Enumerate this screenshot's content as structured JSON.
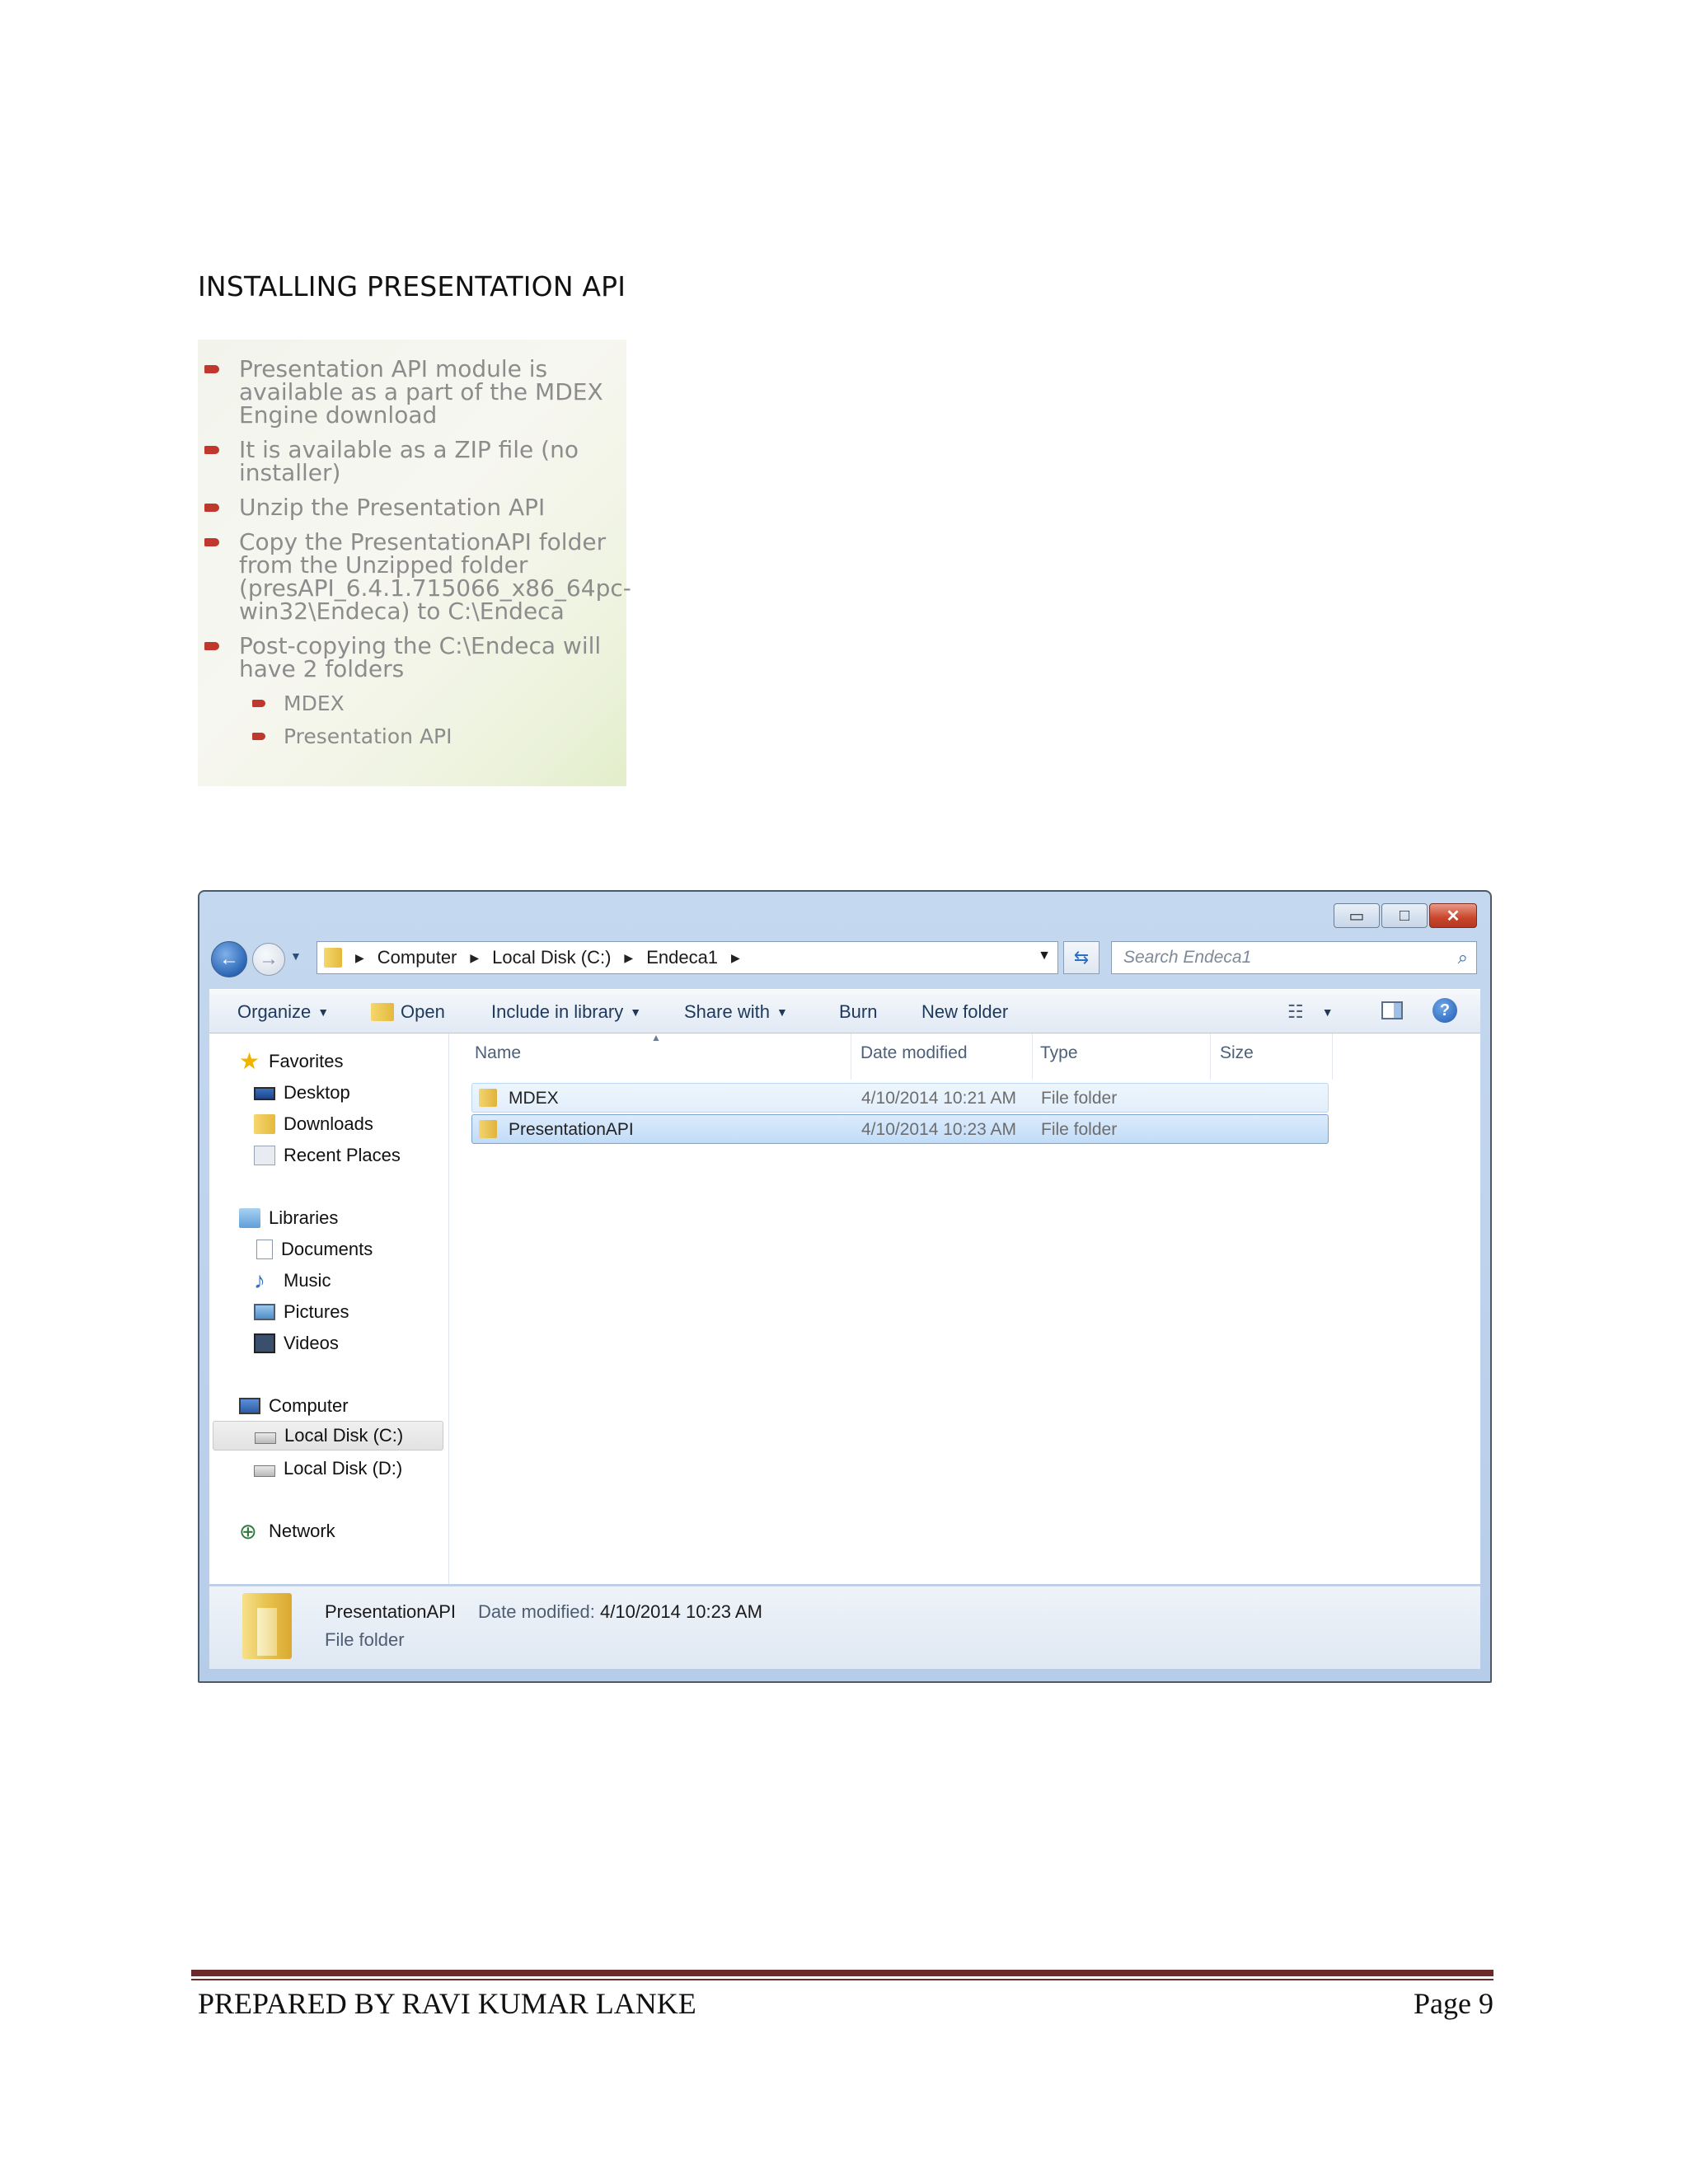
{
  "document": {
    "section_title": "INSTALLING PRESENTATION API",
    "slide_bullets": [
      "Presentation API module is available as a part of the MDEX Engine download",
      "It is available as a ZIP file (no installer)",
      "Unzip the Presentation API",
      "Copy the PresentationAPI folder from the Unzipped folder (presAPI_6.4.1.715066_x86_64pc-win32\\Endeca) to C:\\Endeca",
      "Post-copying the C:\\Endeca will have 2 folders"
    ],
    "slide_subbullets": [
      "MDEX",
      "Presentation API"
    ],
    "footer_left": "PREPARED BY RAVI KUMAR LANKE",
    "footer_right": "Page 9"
  },
  "explorer": {
    "breadcrumb": [
      "Computer",
      "Local Disk (C:)",
      "Endeca1"
    ],
    "search_placeholder": "Search Endeca1",
    "toolbar": {
      "organize": "Organize",
      "open": "Open",
      "include_in_library": "Include in library",
      "share_with": "Share with",
      "burn": "Burn",
      "new_folder": "New folder"
    },
    "nav": {
      "favorites": "Favorites",
      "desktop": "Desktop",
      "downloads": "Downloads",
      "recent_places": "Recent Places",
      "libraries": "Libraries",
      "documents": "Documents",
      "music": "Music",
      "pictures": "Pictures",
      "videos": "Videos",
      "computer": "Computer",
      "local_disk_c": "Local Disk (C:)",
      "local_disk_d": "Local Disk (D:)",
      "network": "Network"
    },
    "columns": {
      "name": "Name",
      "date_modified": "Date modified",
      "type": "Type",
      "size": "Size"
    },
    "rows": [
      {
        "name": "MDEX",
        "date": "4/10/2014 10:21 AM",
        "type": "File folder"
      },
      {
        "name": "PresentationAPI",
        "date": "4/10/2014 10:23 AM",
        "type": "File folder"
      }
    ],
    "details": {
      "name": "PresentationAPI",
      "date_label": "Date modified:",
      "date_value": "4/10/2014 10:23 AM",
      "type": "File folder"
    },
    "icons": {
      "back": "back-arrow-icon",
      "forward": "forward-arrow-icon",
      "refresh": "refresh-icon",
      "search": "search-icon",
      "help": "help-icon"
    }
  }
}
